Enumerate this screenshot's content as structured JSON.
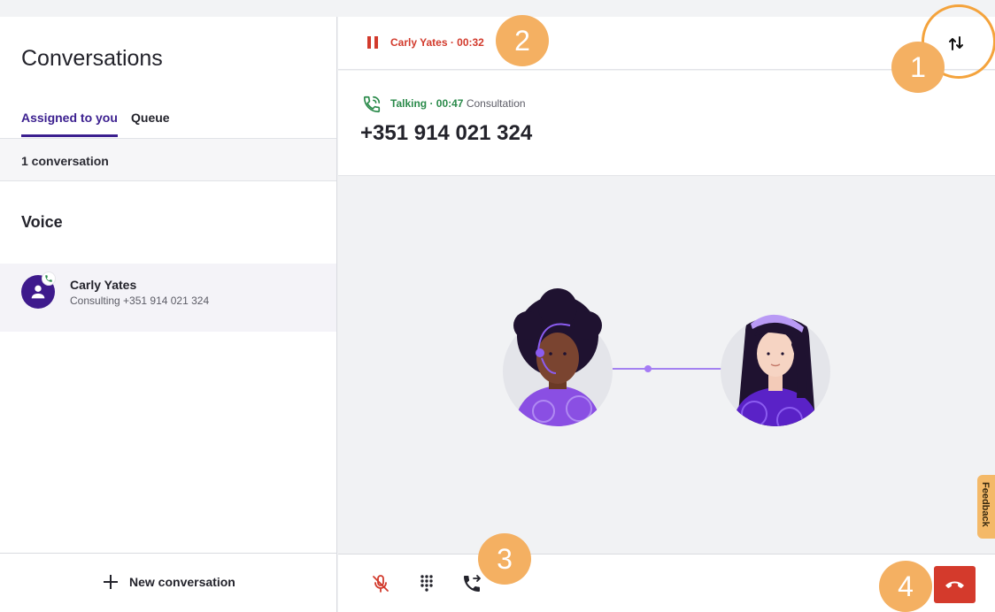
{
  "sidebar": {
    "title": "Conversations",
    "tabs": [
      {
        "label": "Assigned to you",
        "active": true
      },
      {
        "label": "Queue",
        "active": false
      }
    ],
    "count_text": "1 conversation",
    "section_label": "Voice",
    "conversation": {
      "name": "Carly Yates",
      "subtitle": "Consulting +351 914 021 324",
      "avatar_icon": "person-icon",
      "badge_icon": "phone-icon"
    },
    "new_conversation_label": "New conversation"
  },
  "held_call": {
    "text": "Carly Yates · 00:32",
    "icon": "pause-icon",
    "swap_icon": "swap-calls-icon"
  },
  "active_call": {
    "status": "Talking · 00:47",
    "kind": "Consultation",
    "number": "+351 914 021 324",
    "icon": "phone-in-talk-icon"
  },
  "feedback_label": "Feedback",
  "controls": {
    "mute_icon": "mic-off-icon",
    "keypad_icon": "dialpad-icon",
    "transfer_icon": "phone-forward-icon",
    "hangup_icon": "call-end-icon"
  },
  "callouts": [
    "1",
    "2",
    "3",
    "4"
  ],
  "colors": {
    "accent": "#3b1f8f",
    "hold": "#d23a2c",
    "talking": "#2a8a4a",
    "hangup": "#d43a2c",
    "callout": "#f4b062"
  }
}
